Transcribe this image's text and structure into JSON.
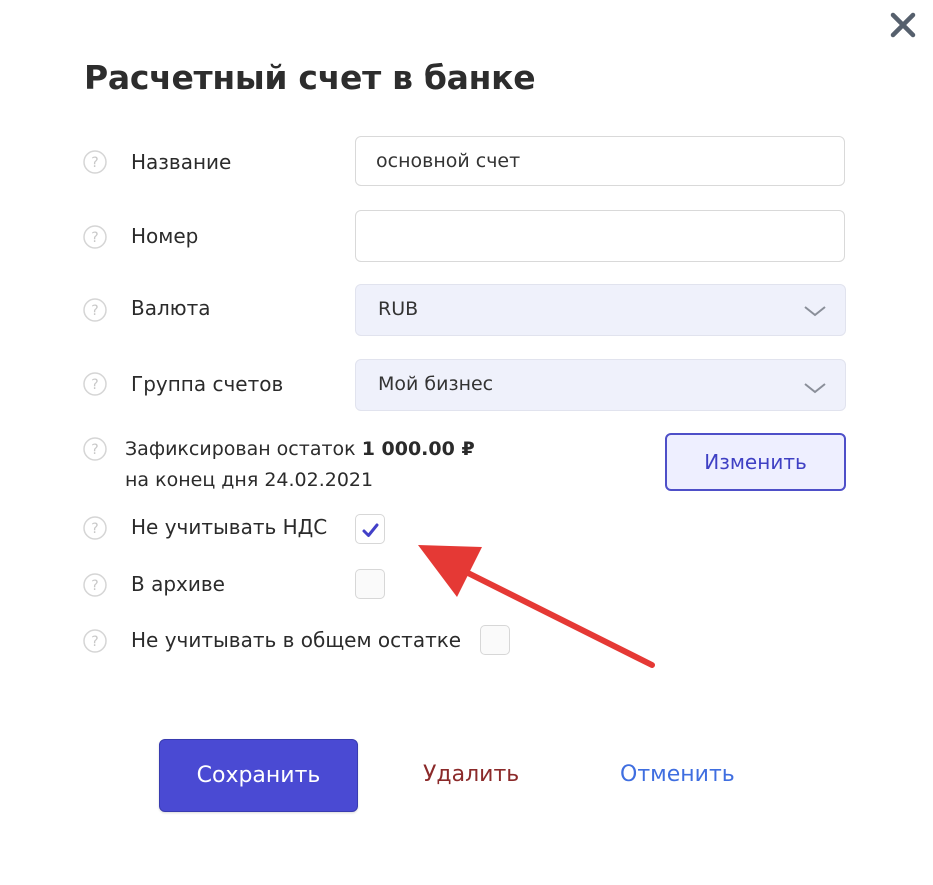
{
  "dialog": {
    "title": "Расчетный счет в банке",
    "close_icon": "close-x-icon"
  },
  "fields": {
    "name": {
      "label": "Название",
      "value": "основной счет",
      "placeholder": ""
    },
    "number": {
      "label": "Номер",
      "value": "",
      "placeholder": ""
    },
    "currency": {
      "label": "Валюта",
      "value": "RUB"
    },
    "group": {
      "label": "Группа счетов",
      "value": "Мой бизнес"
    }
  },
  "balance": {
    "prefix": "Зафиксирован остаток",
    "amount": "1 000.00 ₽",
    "line2": "на конец дня 24.02.2021",
    "change_label": "Изменить"
  },
  "checkboxes": {
    "exclude_vat": {
      "label": "Не учитывать НДС",
      "checked": true
    },
    "archived": {
      "label": "В архиве",
      "checked": false
    },
    "exclude_total": {
      "label": "Не учитывать в общем остатке",
      "checked": false
    }
  },
  "actions": {
    "save": "Сохранить",
    "delete": "Удалить",
    "cancel": "Отменить"
  },
  "colors": {
    "primary": "#4a4ad3",
    "delete": "#8b2a2a",
    "cancel": "#3f6ee0",
    "annotation_arrow": "#e53935"
  }
}
